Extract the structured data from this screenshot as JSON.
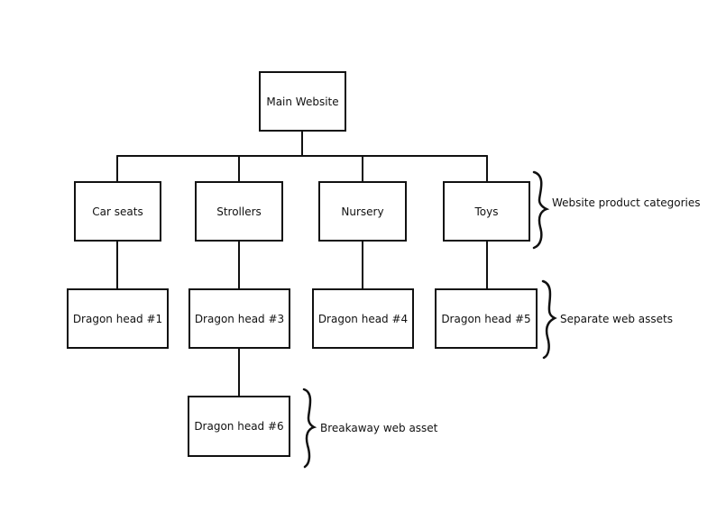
{
  "root": {
    "label": "Main Website"
  },
  "categories": [
    {
      "label": "Car seats"
    },
    {
      "label": "Strollers"
    },
    {
      "label": "Nursery"
    },
    {
      "label": "Toys"
    }
  ],
  "assets": [
    {
      "label": "Dragon head #1"
    },
    {
      "label": "Dragon head #3"
    },
    {
      "label": "Dragon head #4"
    },
    {
      "label": "Dragon head #5"
    }
  ],
  "breakaway": {
    "label": "Dragon head #6"
  },
  "annotations": {
    "categories": "Website product categories",
    "assets": "Separate web assets",
    "breakaway": "Breakaway web asset"
  }
}
